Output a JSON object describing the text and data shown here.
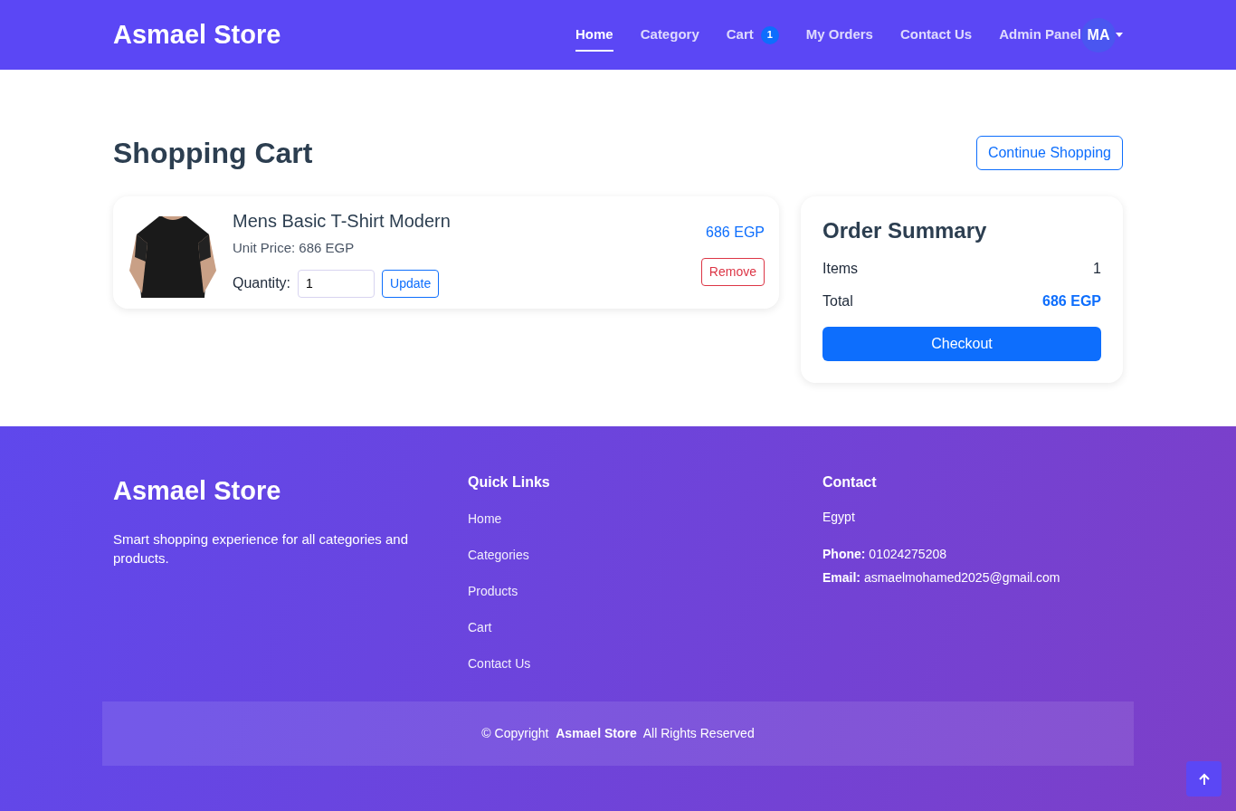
{
  "header": {
    "brand": "Asmael Store",
    "nav": [
      {
        "label": "Home",
        "selected": true
      },
      {
        "label": "Category",
        "selected": false
      },
      {
        "label": "Cart",
        "selected": false,
        "badge": "1"
      },
      {
        "label": "My Orders",
        "selected": false
      },
      {
        "label": "Contact Us",
        "selected": false
      },
      {
        "label": "Admin Panel",
        "selected": false
      }
    ],
    "avatar": "MA"
  },
  "page": {
    "title": "Shopping Cart",
    "continue_button": "Continue Shopping"
  },
  "cart_items": [
    {
      "name": "Mens Basic T-Shirt Modern",
      "unit_price": "Unit Price: 686 EGP",
      "quantity_label": "Quantity:",
      "quantity": "1",
      "update_button": "Update",
      "line_total": "686 EGP",
      "remove_button": "Remove"
    }
  ],
  "summary": {
    "title": "Order Summary",
    "rows": [
      {
        "label": "Items",
        "value": "1",
        "kind": "plain"
      },
      {
        "label": "Total",
        "value": "686 EGP",
        "kind": "total"
      }
    ],
    "checkout_button": "Checkout"
  },
  "footer": {
    "brand": "Asmael Store",
    "tagline": "Smart shopping experience for all categories and products.",
    "quick_links": {
      "title": "Quick Links",
      "links": [
        "Home",
        "Categories",
        "Products",
        "Cart",
        "Contact Us"
      ]
    },
    "contact": {
      "title": "Contact",
      "lines": [
        "Egypt",
        "**Phone:** 01024275208",
        "**Email:** asmaelmohamed2025@gmail.com"
      ]
    },
    "copyright": "© Copyright  **Asmael Store**  All Rights Reserved"
  }
}
